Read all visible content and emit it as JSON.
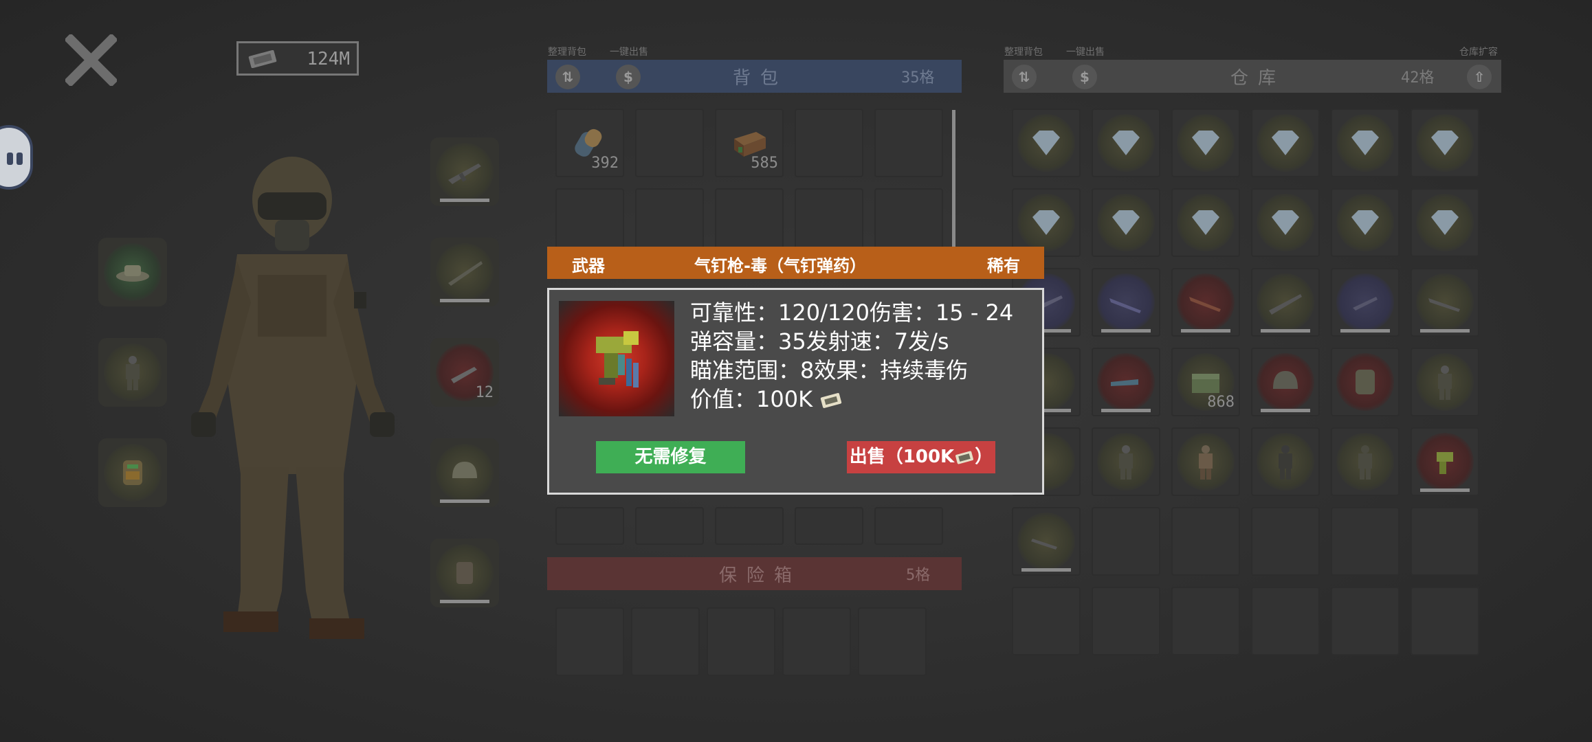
{
  "hud": {
    "money": "124M"
  },
  "backpack": {
    "organize_label": "整理背包",
    "sell_all_label": "一键出售",
    "title": "背包",
    "slots": "35格",
    "items": [
      {
        "name": "bandage",
        "count": "392"
      },
      {
        "name": "empty",
        "count": ""
      },
      {
        "name": "ammo-box",
        "count": "585"
      }
    ]
  },
  "safe": {
    "title": "保险箱",
    "slots": "5格"
  },
  "warehouse": {
    "organize_label": "整理背包",
    "sell_all_label": "一键出售",
    "expand_label": "仓库扩容",
    "title": "仓库",
    "slots": "42格",
    "counts": {
      "ammo_crate": "868"
    }
  },
  "equipment": {
    "ammo_count": "12"
  },
  "tooltip": {
    "category": "武器",
    "item_name": "气钉枪-毒（气钉弹药）",
    "rarity": "稀有",
    "stat_line1": "可靠性：120/120伤害：15 - 24",
    "stat_line2": "弹容量：35发射速：7发/s",
    "stat_line3": "瞄准范围：8效果：持续毒伤",
    "stat_line4": "价值：100K",
    "repair_button": "无需修复",
    "sell_button": "出售（100K",
    "sell_button_end": "）"
  },
  "colors": {
    "backpack_header": "#39465f",
    "warehouse_header": "#474747",
    "safe_header": "#5a3434",
    "modal_header": "#b85f19",
    "repair_btn": "#3fae55",
    "sell_btn": "#c74141"
  }
}
